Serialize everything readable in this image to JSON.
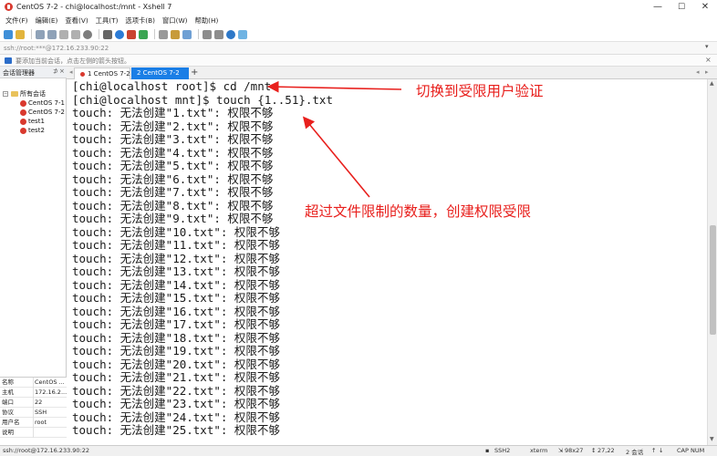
{
  "window": {
    "title": "CentOS 7-2 - chi@localhost:/mnt - Xshell 7",
    "minimize": "—",
    "maximize": "☐",
    "close": "✕"
  },
  "menu": [
    "文件(F)",
    "编辑(E)",
    "查看(V)",
    "工具(T)",
    "选项卡(B)",
    "窗口(W)",
    "帮助(H)"
  ],
  "address": {
    "value": "ssh://root:***@172.16.233.90:22"
  },
  "info": {
    "text": "要添加当前会话，点击左侧的箭头按钮。"
  },
  "session_panel": {
    "title": "会话管理器",
    "pin": "⊅",
    "close": "×",
    "root": "所有会话",
    "sessions": [
      "CentOS 7-1",
      "CentOS 7-2",
      "test1",
      "test2"
    ]
  },
  "properties": [
    {
      "key": "名称",
      "value": "CentOS ..."
    },
    {
      "key": "主机",
      "value": "172.16.2..."
    },
    {
      "key": "端口",
      "value": "22"
    },
    {
      "key": "协议",
      "value": "SSH"
    },
    {
      "key": "用户名",
      "value": "root"
    },
    {
      "key": "说明",
      "value": ""
    }
  ],
  "tabs": {
    "tab1": "1 CentOS 7-2",
    "tab2": "2 CentOS 7-2",
    "add": "+"
  },
  "terminal": {
    "lines": [
      "[chi@localhost root]$ cd /mnt",
      "[chi@localhost mnt]$ touch {1..51}.txt",
      "touch: 无法创建\"1.txt\": 权限不够",
      "touch: 无法创建\"2.txt\": 权限不够",
      "touch: 无法创建\"3.txt\": 权限不够",
      "touch: 无法创建\"4.txt\": 权限不够",
      "touch: 无法创建\"5.txt\": 权限不够",
      "touch: 无法创建\"6.txt\": 权限不够",
      "touch: 无法创建\"7.txt\": 权限不够",
      "touch: 无法创建\"8.txt\": 权限不够",
      "touch: 无法创建\"9.txt\": 权限不够",
      "touch: 无法创建\"10.txt\": 权限不够",
      "touch: 无法创建\"11.txt\": 权限不够",
      "touch: 无法创建\"12.txt\": 权限不够",
      "touch: 无法创建\"13.txt\": 权限不够",
      "touch: 无法创建\"14.txt\": 权限不够",
      "touch: 无法创建\"15.txt\": 权限不够",
      "touch: 无法创建\"16.txt\": 权限不够",
      "touch: 无法创建\"17.txt\": 权限不够",
      "touch: 无法创建\"18.txt\": 权限不够",
      "touch: 无法创建\"19.txt\": 权限不够",
      "touch: 无法创建\"20.txt\": 权限不够",
      "touch: 无法创建\"21.txt\": 权限不够",
      "touch: 无法创建\"22.txt\": 权限不够",
      "touch: 无法创建\"23.txt\": 权限不够",
      "touch: 无法创建\"24.txt\": 权限不够",
      "touch: 无法创建\"25.txt\": 权限不够"
    ]
  },
  "annotations": {
    "switch_user": "切换到受限用户验证",
    "exceed_limit": "超过文件限制的数量，创建权限受限",
    "color": "#e8201d"
  },
  "status": {
    "connection": "ssh://root@172.16.233.90:22",
    "protocol": "SSH2",
    "terminal": "xterm",
    "size": "98x27",
    "cursor": "27,22",
    "sessions": "2 会话",
    "caps": "CAP NUM"
  },
  "toolbar_icons": [
    "new-session-icon",
    "open-folder-icon",
    "disconnect-icon",
    "reconnect-icon",
    "copy-icon",
    "paste-icon",
    "search-icon",
    "print-icon",
    "globe-icon",
    "xftp-icon",
    "transfer-icon",
    "keyboard-icon",
    "lock-icon",
    "compose-icon",
    "layout-icon",
    "fullscreen-icon",
    "help-icon",
    "chat-icon"
  ]
}
